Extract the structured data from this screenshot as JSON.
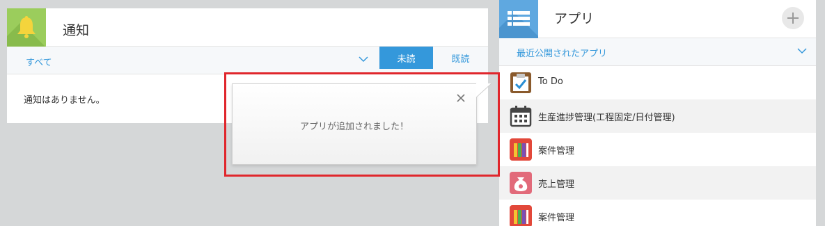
{
  "notifications": {
    "title": "通知",
    "filter_label": "すべて",
    "tab_unread": "未読",
    "tab_read": "既読",
    "empty_message": "通知はありません。",
    "icon": "bell-icon"
  },
  "apps": {
    "title": "アプリ",
    "filter_label": "最近公開されたアプリ",
    "icon": "list-icon",
    "add_icon": "plus-icon",
    "items": [
      {
        "label": "To Do",
        "icon": "todo-clipboard-icon"
      },
      {
        "label": "生産進捗管理(工程固定/日付管理)",
        "icon": "calendar-icon"
      },
      {
        "label": "案件管理",
        "icon": "binders-icon"
      },
      {
        "label": "売上管理",
        "icon": "money-bag-icon"
      },
      {
        "label": "案件管理",
        "icon": "binders-icon"
      }
    ]
  },
  "popup": {
    "message": "アプリが追加されました！",
    "close_icon": "close-icon"
  },
  "colors": {
    "accent_blue": "#3498db",
    "notify_green": "#9bcd5c",
    "apps_blue": "#5fa8e0",
    "highlight_red": "#e0262c"
  }
}
